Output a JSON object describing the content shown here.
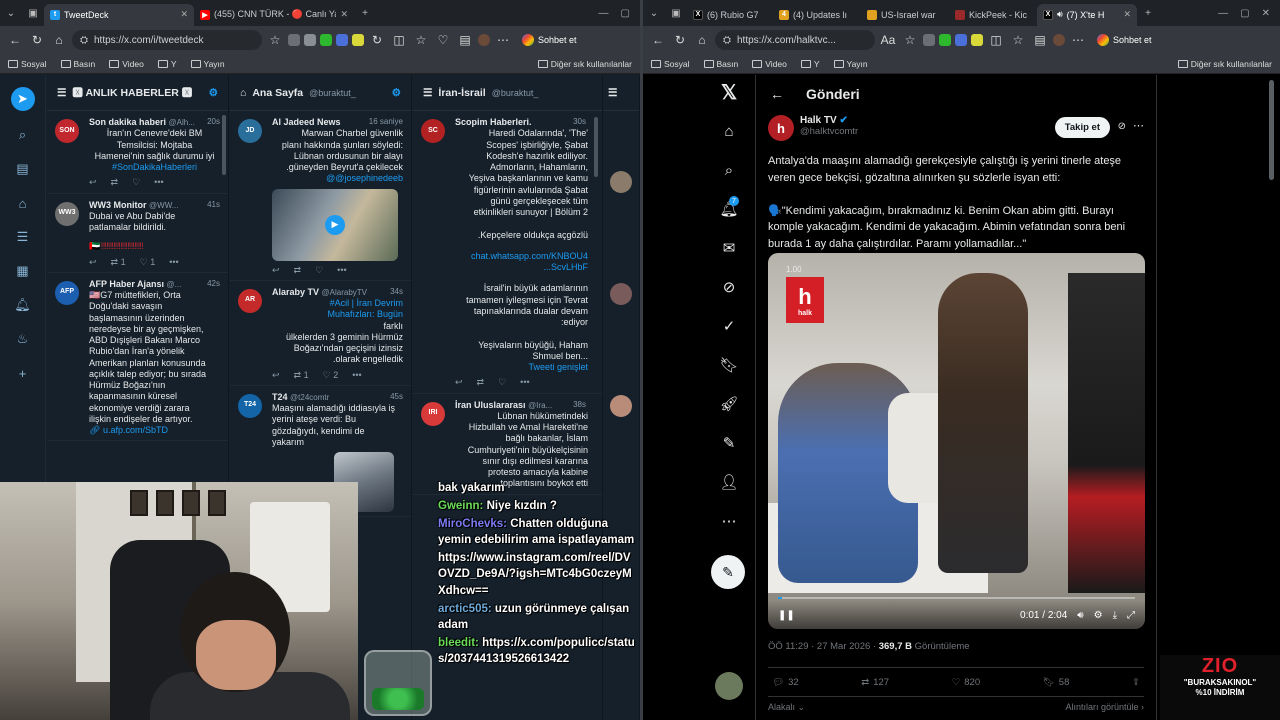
{
  "left_browser": {
    "tabs": [
      {
        "title": "TweetDeck",
        "active": true
      },
      {
        "title": "(455) CNN TÜRK - 🔴 Canlı Yayın ·",
        "active": false
      }
    ],
    "url": "https://x.com/i/tweetdeck",
    "sohbet": "Sohbet et",
    "bookmarks": [
      "Sosyal",
      "Basın",
      "Video",
      "Y",
      "Yayın"
    ],
    "bookmarks_other": "Diğer sık kullanılanlar"
  },
  "tweetdeck": {
    "columns": [
      {
        "title": "🆇 ANLIK HABERLER 🆇",
        "handle": "",
        "tweets": [
          {
            "name": "Son dakika haberi",
            "handle": "@Alh...",
            "time": "20s",
            "avatar": "SON",
            "avatar_color": "#c0282d",
            "text": "İran'ın Cenevre'deki BM\nTemsilcisi: Mojtaba\nHamenei'nin sağlık durumu iyi",
            "link": "#SonDakikaHaberleri",
            "replies": "",
            "rts": "",
            "likes": ""
          },
          {
            "name": "WW3 Monitor",
            "handle": "@WW...",
            "time": "41s",
            "avatar": "WW3",
            "avatar_color": "#6f6f6f",
            "text": "Dubai ve Abu Dabi'de\npatlamalar bildirildi.",
            "link": "",
            "replies": "",
            "rts": "1",
            "likes": "1"
          },
          {
            "name": "AFP Haber Ajansı",
            "handle": "@...",
            "time": "42s",
            "avatar": "AFP",
            "avatar_color": "#1c5fb0",
            "text": "🇺🇸G7 müttefikleri, Orta\nDoğu'daki savaşın\nbaşlamasının üzerinden\nneredeyse bir ay geçmişken,\nABD Dışişleri Bakanı Marco\nRubio'dan İran'a yönelik\nAmerikan planları konusunda\naçıklık talep ediyor; bu sırada\nHürmüz Boğazı'nın\nkapanmasının küresel\nekonomiye verdiği zarara\nilişkin endişeler de artıyor.",
            "link": "u.afp.com/SbTD",
            "replies": "",
            "rts": "",
            "likes": ""
          }
        ]
      },
      {
        "title": "Ana Sayfa",
        "handle": "@buraktut_",
        "tweets": [
          {
            "name": "Al Jadeed News",
            "handle": "",
            "time": "16 saniye",
            "avatar": "JD",
            "avatar_color": "#2a6e9c",
            "text": "Marwan Charbel güvenlik\nplanı hakkında şunları söyledi:\nLübnan ordusunun bir alayı\n.güneyden Beyrut'a çekilecek",
            "link": "@@josephinedeeb",
            "replies": "",
            "rts": "",
            "likes": ""
          },
          {
            "name": "Alaraby TV",
            "handle": "@AlarabyTV",
            "time": "34s",
            "avatar": "AR",
            "avatar_color": "#c42a2a",
            "text": "farklı",
            "link": "#Acil | İran Devrim\nMuhafızları: Bugün",
            "text2": "ülkelerden 3 geminin Hürmüz\nBoğazı'ndan geçişini izinsiz\n.olarak engelledik",
            "replies": "",
            "rts": "1",
            "likes": "2"
          },
          {
            "name": "T24",
            "handle": "@t24comtr",
            "time": "45s",
            "avatar": "T24",
            "avatar_color": "#1465a8",
            "text": "Maaşını alamadığı iddiasıyla iş\nyerini ateşe verdi: Bu\ngözdağıydı, kendimi de\nyakarım",
            "link": "",
            "replies": "",
            "rts": "",
            "likes": ""
          }
        ]
      },
      {
        "title": "İran-İsrail",
        "handle": "@buraktut_",
        "tweets": [
          {
            "name": "Scopim Haberleri.",
            "handle": "",
            "time": "30s",
            "avatar": "SC",
            "avatar_color": "#b22222",
            "text": "Haredi Odalarında', 'The'\nScopes' işbirliğiyle, Şabat\nKodesh'e hazırlık ediliyor.\nAdmorların, Hahamların,\nYeşiva başkanlarının ve kamu\nfigürlerinin avlularında Şabat\ngünü gerçekleşecek tüm\netkinlikleri sunuyor | Bölüm 2\n\n.Kepçelere oldukça açgözlü",
            "link": "chat.whatsapp.com/KNBOU4\n...ScvLHbF",
            "text2": "İsrail'in büyük adamlarının\ntamamen iyileşmesi için Tevrat\ntapınaklarında dualar devam\n:ediyor\n\nYeşivaların büyüğü, Haham\nShmuel ben...",
            "more": "Tweeti genişlet",
            "replies": "",
            "rts": "",
            "likes": ""
          },
          {
            "name": "İran Uluslararası",
            "handle": "@Ira...",
            "time": "38s",
            "avatar": "IRI",
            "avatar_color": "#d83a3a",
            "text": "Lübnan hükümetindeki\nHizbullah ve Amal Hareketi'ne\nbağlı bakanlar, İslam\nCumhuriyeti'nin büyükelçisinin\nsınır dışı edilmesi kararına\nprotesto amacıyla kabine\n.toplantısını boykot etti",
            "link": "",
            "replies": "",
            "rts": "",
            "likes": ""
          }
        ]
      }
    ]
  },
  "stream_chat": [
    {
      "user": "",
      "msg": "bak yakarım"
    },
    {
      "user": "Gweinn:",
      "msg": "Niye kızdın ?"
    },
    {
      "user": "MiroChevks:",
      "msg": "Chatten olduğuna yemin edebilirim ama ispatlayamam"
    },
    {
      "user": "",
      "msg": "https://www.instagram.com/reel/DVOVZD_De9A/?igsh=MTc4bG0czeyMXdhcw=="
    },
    {
      "user": "arctic505:",
      "msg": "uzun görünmeye çalışan adam"
    },
    {
      "user": "bleedit:",
      "msg": "https://x.com/populicc/status/2037441319526613422"
    }
  ],
  "right_browser": {
    "tabs": [
      "(6) Rubio G7",
      "(4) Updates lı",
      "US-Israel war",
      "KickPeek - Kic",
      "(7) X'te H"
    ],
    "url": "https://x.com/halktvc...",
    "sohbet": "Sohbet et",
    "bookmarks": [
      "Sosyal",
      "Basın",
      "Video",
      "Y",
      "Yayın"
    ],
    "bookmarks_other": "Diğer sık kullanılanlar"
  },
  "x_post": {
    "header": "Gönderi",
    "author_name": "Halk TV",
    "author_handle": "@halktvcomtr",
    "follow": "Takip et",
    "text": "Antalya'da maaşını alamadığı gerekçesiyle çalıştığı iş yerini tinerle ateşe veren gece bekçisi, gözaltına alınırken şu sözlerle isyan etti:\n\n🗣️\"Kendimi yakacağım, bırakmadınız ki. Benim Okan abim gitti. Burayı komple yakacağım. Kendimi de yakacağım. Abimin vefatından sonra beni burada 1 ay daha çalıştırdılar. Paramı yollamadılar...\"",
    "video_time": "0:01 / 2:04",
    "video_progress": 0.01,
    "video_logo": "h",
    "video_logo_sub": "halk",
    "video_tag": "1.00",
    "meta_time": "ÖÖ 11:29 · 27 Mar 2026 ·",
    "views": "369,7 B",
    "views_label": "Görüntüleme",
    "replies": "32",
    "reposts": "127",
    "likes": "820",
    "bookmarks": "58",
    "related": "Alakalı",
    "quotes": "Alıntıları görüntüle",
    "notifications_badge": "7"
  },
  "ad": {
    "brand": "ZIO",
    "code": "\"BURAKSAKINOL\"",
    "discount": "%10 İNDİRİM"
  },
  "colors": {
    "accent": "#1d9bf0",
    "td_bg": "#15202b",
    "x_bg": "#000000",
    "halk_red": "#d41f26"
  }
}
